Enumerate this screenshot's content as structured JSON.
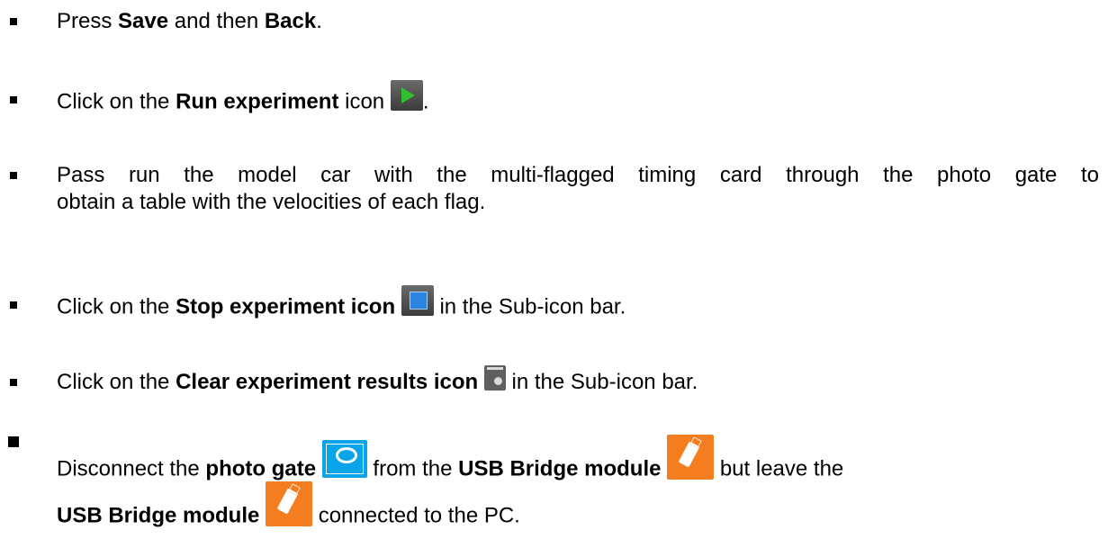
{
  "items": [
    {
      "pre": "Press ",
      "b1": "Save",
      "mid": " and then ",
      "b2": "Back",
      "post": "."
    },
    {
      "pre": "Click on the ",
      "b1": "Run experiment",
      "post": " icon",
      "end": ".",
      "icon": "run-experiment-icon"
    },
    {
      "line1_words": [
        "Pass",
        "run",
        "the",
        "model",
        "car",
        "with",
        "the",
        "multi-flagged",
        "timing",
        "card",
        "through",
        "the",
        "photo",
        "gate",
        "to"
      ],
      "line2": "obtain a table with the velocities of each flag."
    },
    {
      "pre": "Click on the ",
      "b1": "Stop experiment icon",
      "post": " in the Sub-icon bar.",
      "icon": "stop-experiment-icon"
    },
    {
      "pre": "Click on the ",
      "b1": "Clear experiment results icon",
      "post": " in the Sub-icon bar.",
      "icon": "clear-experiment-results-icon"
    },
    {
      "pre": "Disconnect the ",
      "b1": "photo gate",
      "mid": " from the ",
      "b2": "USB Bridge module",
      "post": " but leave the",
      "b3": "USB Bridge module",
      "post2": " connected to the PC.",
      "icons": [
        "photo-gate-icon",
        "usb-bridge-module-icon"
      ]
    }
  ]
}
